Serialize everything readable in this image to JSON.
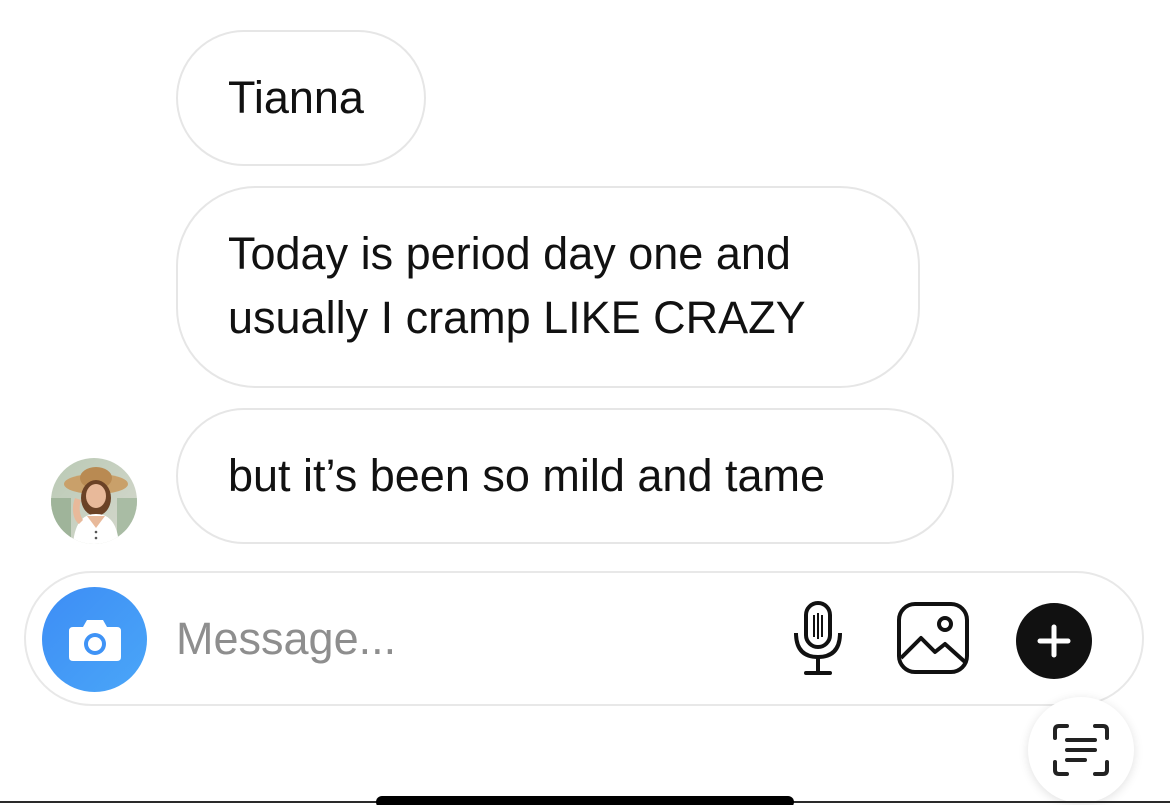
{
  "thread": {
    "messages": [
      {
        "text": "Tianna"
      },
      {
        "text": "Today is period day one and\nusually I cramp LIKE CRAZY"
      },
      {
        "text": "but it’s been so mild and tame"
      }
    ]
  },
  "composer": {
    "placeholder": "Message...",
    "camera_icon": "camera-icon",
    "mic_icon": "microphone-icon",
    "photo_icon": "gallery-icon",
    "plus_icon": "plus-icon",
    "accent_color": "#3d8df5"
  },
  "scan_button": {
    "icon": "text-scan-icon"
  }
}
